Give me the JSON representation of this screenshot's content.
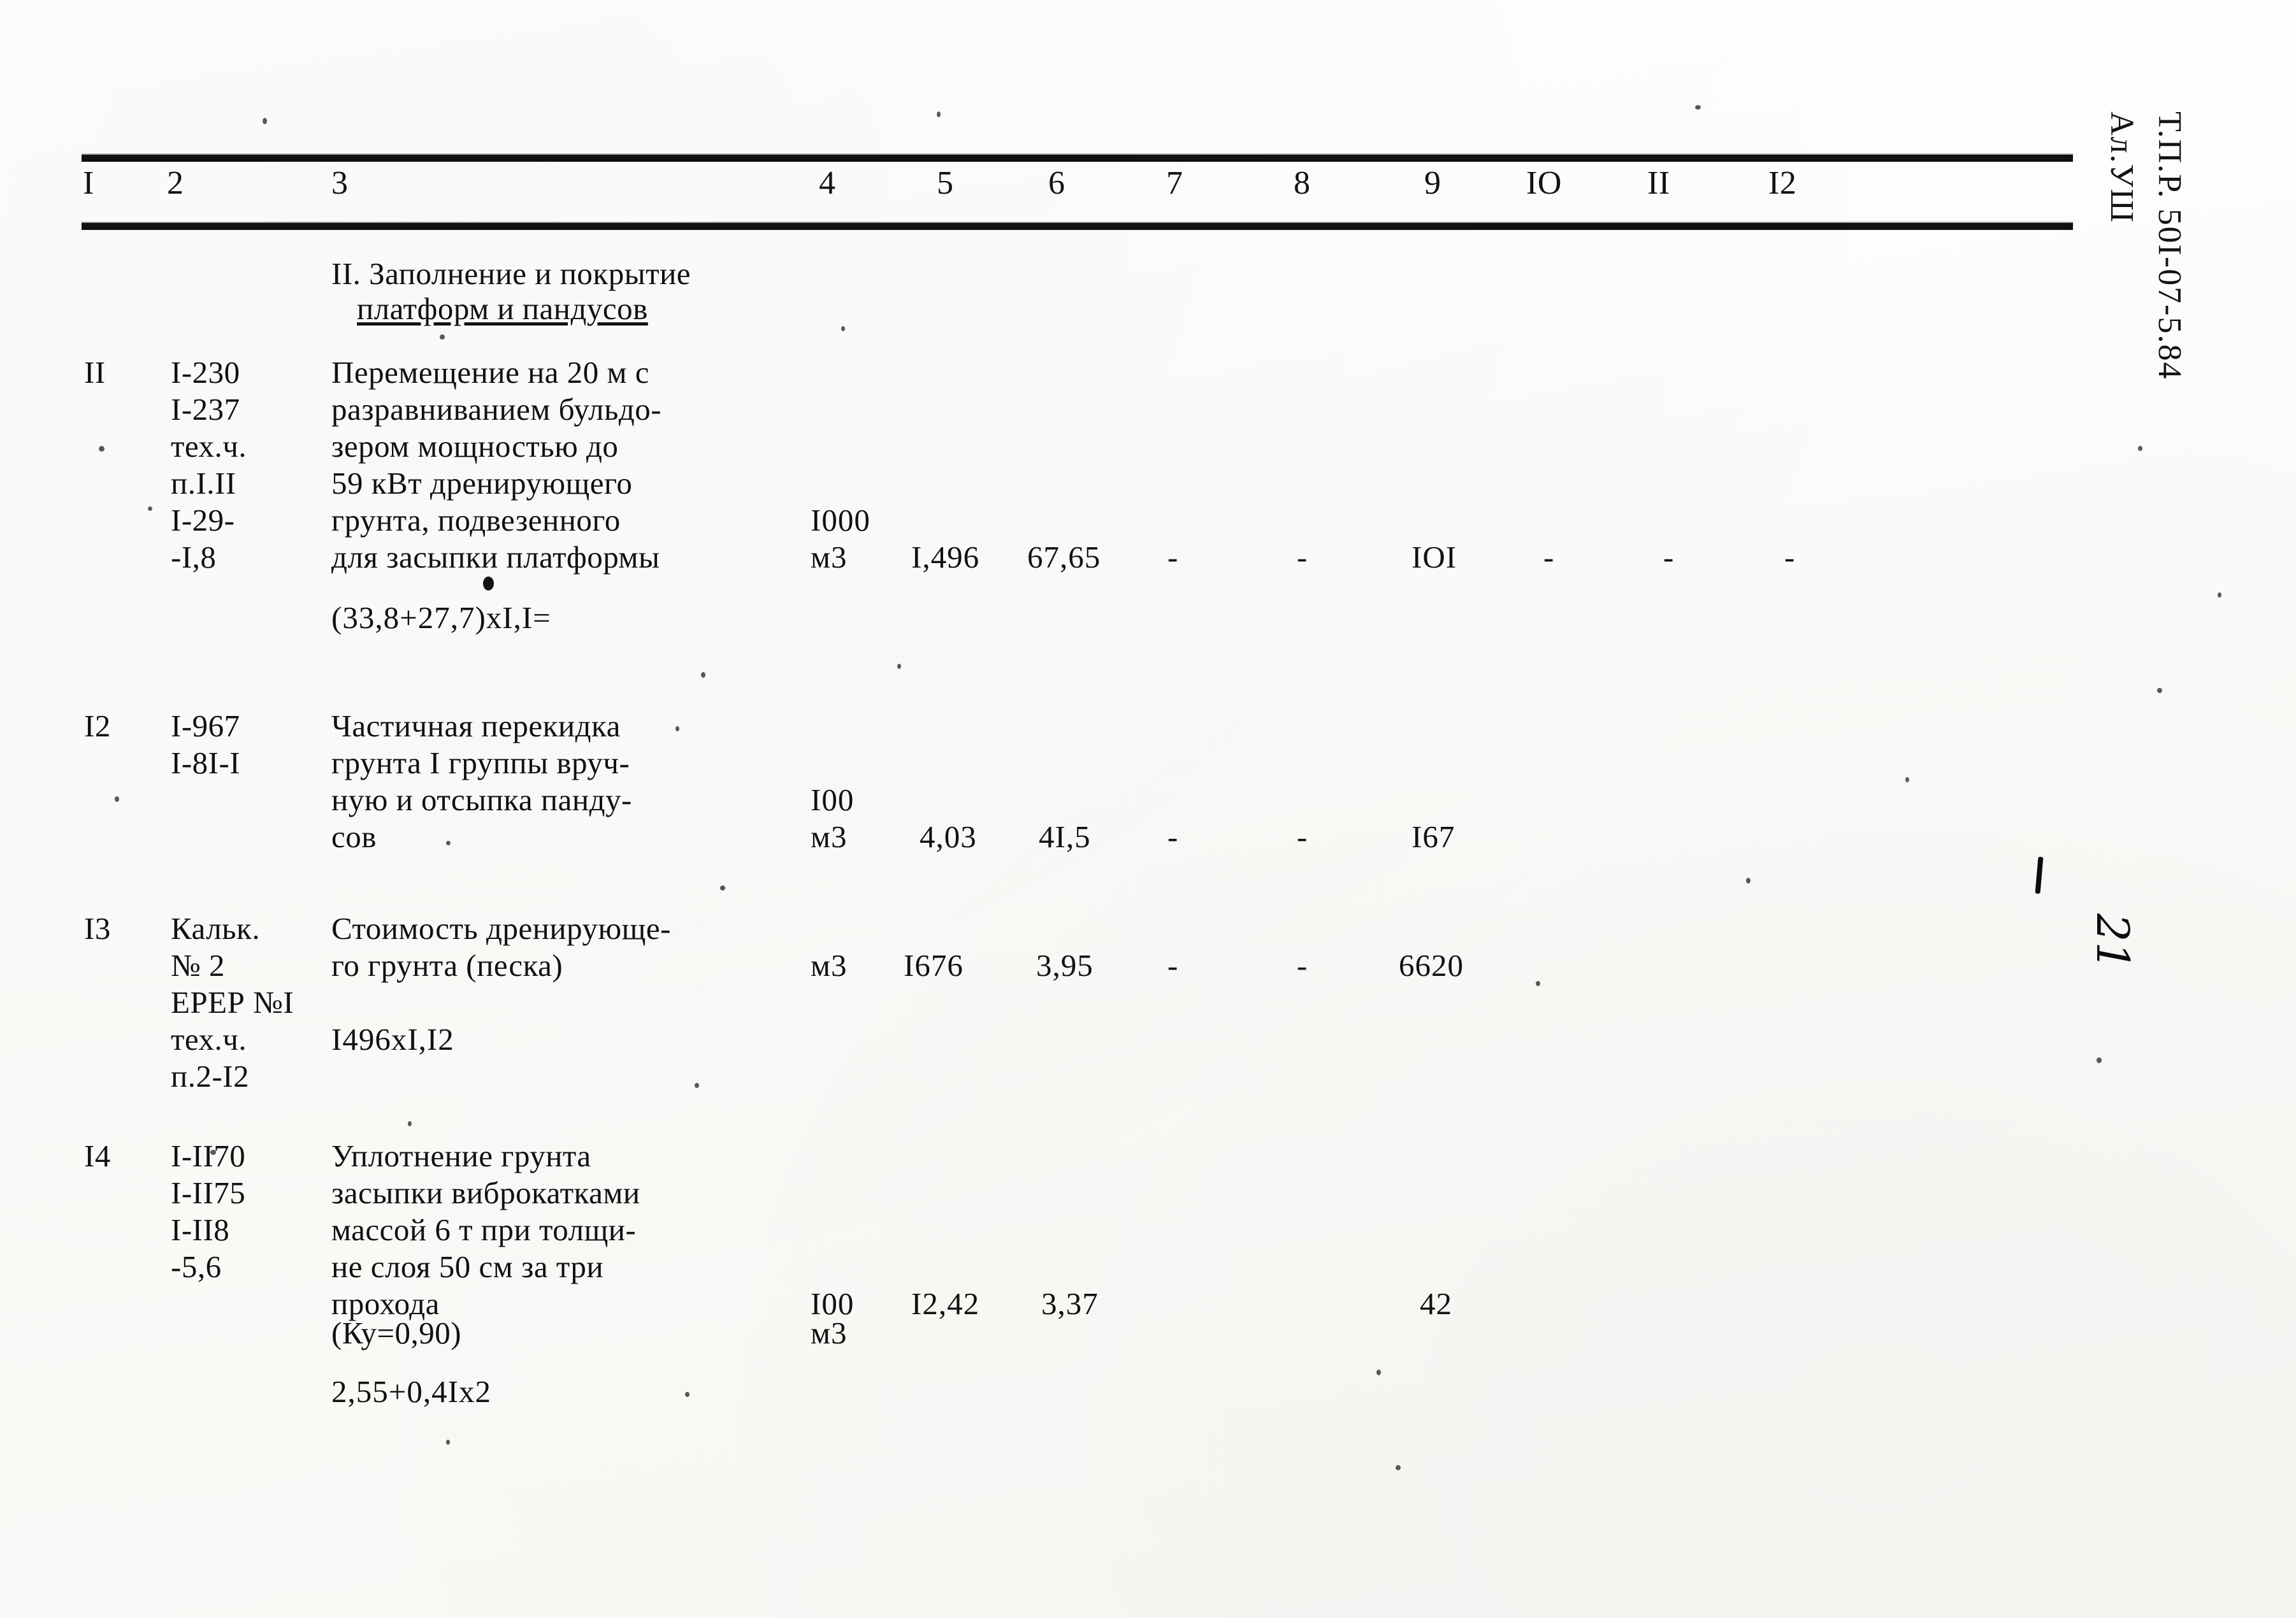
{
  "document": {
    "stamp_line1": "Т.П.Р. 50I-07-5.84",
    "stamp_line2": "Ал.УШ",
    "page_number_handwritten": "21"
  },
  "table": {
    "column_headers": [
      "I",
      "2",
      "3",
      "4",
      "5",
      "6",
      "7",
      "8",
      "9",
      "IO",
      "II",
      "I2"
    ],
    "section_title_line1": "II. Заполнение и покрытие",
    "section_title_line2": "платформ и пандусов",
    "rows": [
      {
        "no": "II",
        "code_lines": [
          "I-230",
          "I-237",
          "тех.ч.",
          "п.I.II",
          "I-29-",
          "-I,8"
        ],
        "desc_lines": [
          "Перемещение на 20 м с",
          "разравниванием бульдо-",
          "зером мощностью до",
          "59 кВт дренирующего",
          "грунта, подвезенного",
          "для засыпки платформы"
        ],
        "formula": "(33,8+27,7)xI,I=",
        "unit_line1": "I000",
        "unit_line2": "м3",
        "c5": "I,496",
        "c6": "67,65",
        "c7": "-",
        "c8": "-",
        "c9": "IOI",
        "c10": "-",
        "c11": "-",
        "c12": "-"
      },
      {
        "no": "I2",
        "code_lines": [
          "I-967",
          "I-8I-I"
        ],
        "desc_lines": [
          "Частичная перекидка",
          "грунта I группы вруч-",
          "ную и отсыпка панду-",
          "сов"
        ],
        "formula": "",
        "unit_line1": "I00",
        "unit_line2": "м3",
        "c5": "4,03",
        "c6": "4I,5",
        "c7": "-",
        "c8": "-",
        "c9": "I67",
        "c10": "",
        "c11": "",
        "c12": ""
      },
      {
        "no": "I3",
        "code_lines": [
          "Кальк.",
          "№ 2",
          "ЕРЕР №I",
          "тех.ч.",
          "п.2-I2"
        ],
        "desc_lines": [
          "Стоимость дренирующе-",
          "го грунта (песка)"
        ],
        "formula": "I496xI,I2",
        "unit_line1": "",
        "unit_line2": "м3",
        "c5": "I676",
        "c6": "3,95",
        "c7": "-",
        "c8": "-",
        "c9": "6620",
        "c10": "",
        "c11": "",
        "c12": ""
      },
      {
        "no": "I4",
        "code_lines": [
          "I-II70",
          "I-II75",
          "I-II8",
          "-5,6"
        ],
        "desc_lines": [
          "Уплотнение грунта",
          "засыпки виброкатками",
          "массой 6 т при толщи-",
          "не слоя 50 см за три",
          "прохода",
          "(Ку=0,90)"
        ],
        "formula": "2,55+0,4Ix2",
        "unit_line1": "I00",
        "unit_line2": "м3",
        "c5": "I2,42",
        "c6": "3,37",
        "c7": "",
        "c8": "",
        "c9": "42",
        "c10": "",
        "c11": "",
        "c12": ""
      }
    ]
  }
}
